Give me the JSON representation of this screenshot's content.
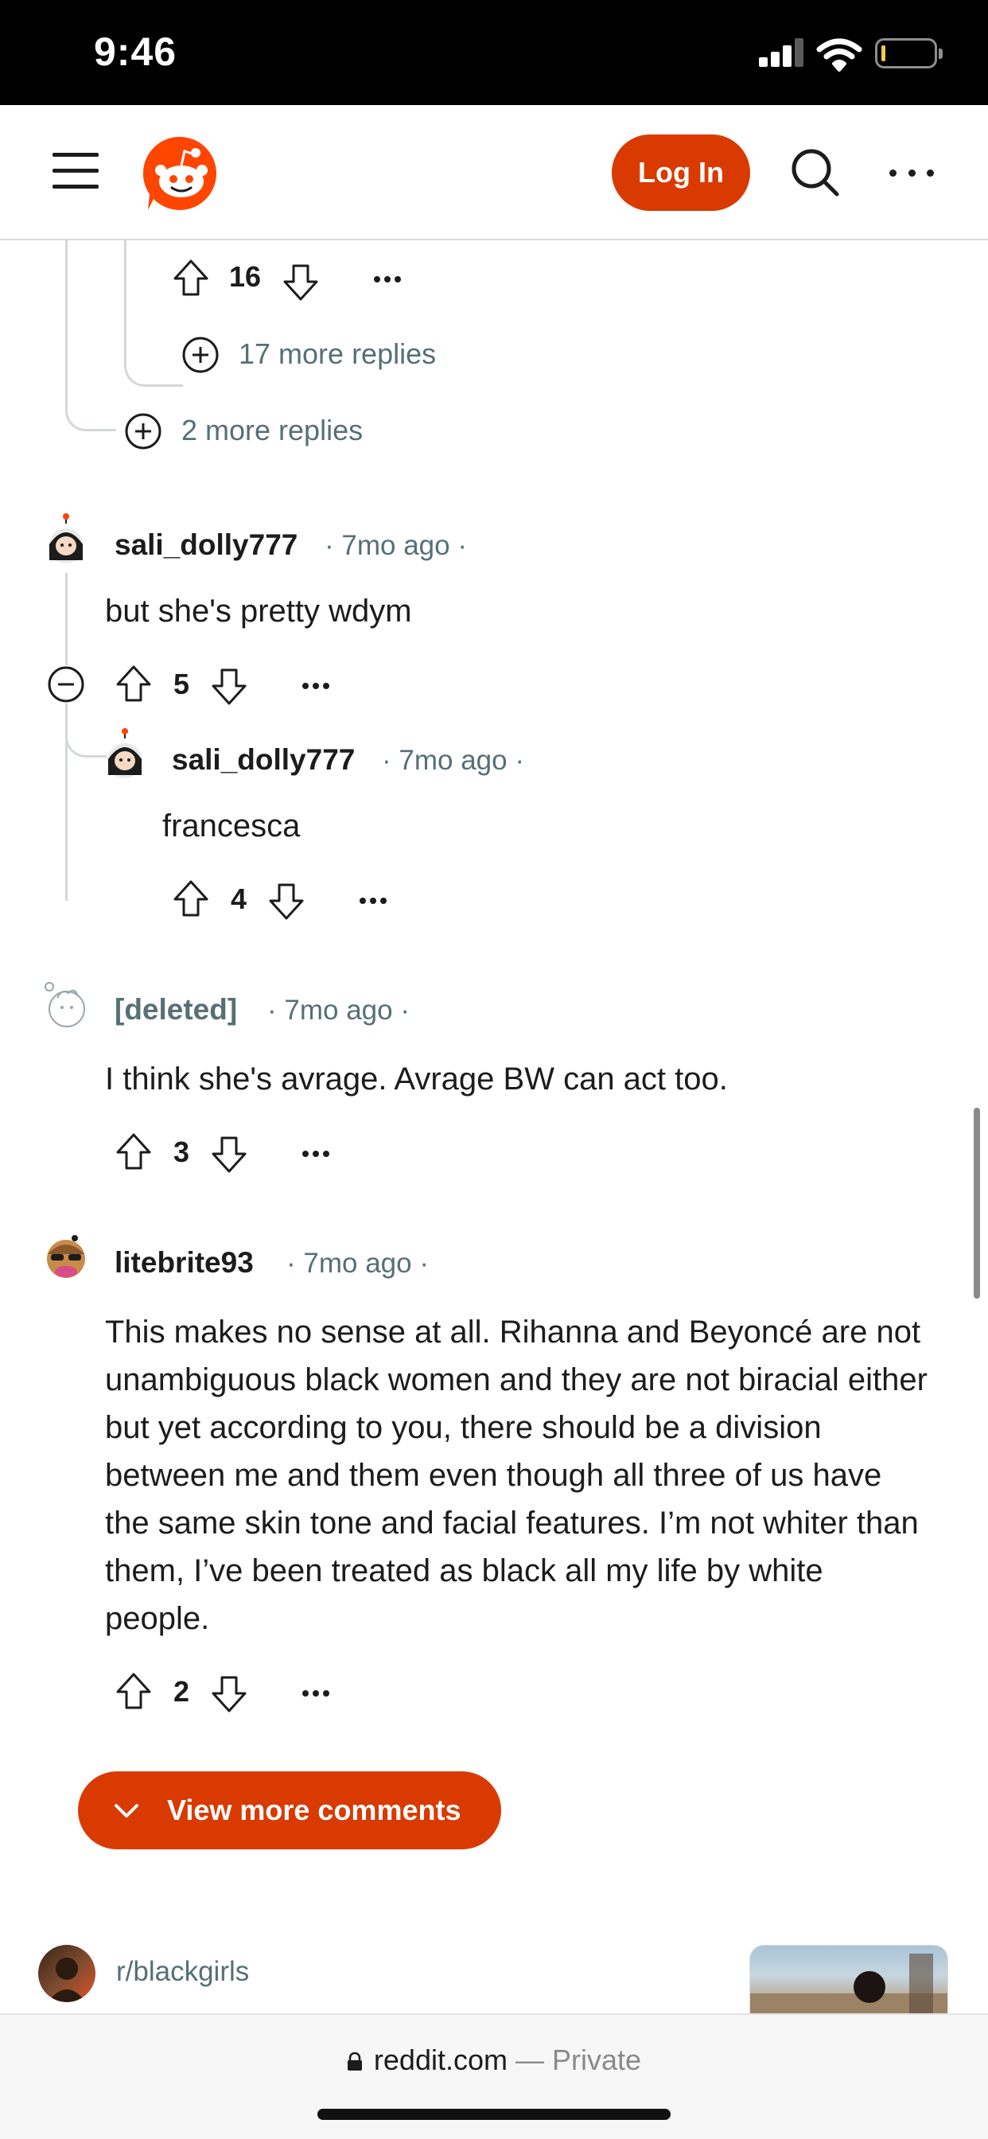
{
  "status_bar": {
    "time": "9:46"
  },
  "header": {
    "login_label": "Log In"
  },
  "partial_comment": {
    "votes": "16",
    "nested_more_replies": "17 more replies",
    "more_replies": "2 more replies"
  },
  "comments": [
    {
      "author": "sali_dolly777",
      "time": "7mo ago",
      "text": "but she's pretty wdym",
      "votes": "5"
    },
    {
      "author": "sali_dolly777",
      "time": "7mo ago",
      "text": "francesca",
      "votes": "4"
    },
    {
      "author": "[deleted]",
      "time": "7mo ago",
      "text": "I think she's avrage. Avrage BW can act too.",
      "votes": "3"
    },
    {
      "author": "litebrite93",
      "time": "7mo ago",
      "text": "This makes no sense at all. Rihanna and Beyoncé are not unambiguous black women and they are not biracial either but yet according to you, there should be a division between me and them even though all three of us have the same skin tone and facial features. I’m not whiter than them, I’ve been treated as black all my life by white people.",
      "votes": "2"
    }
  ],
  "view_more_label": "View more comments",
  "related": {
    "subreddit": "r/blackgirls"
  },
  "browser": {
    "domain": "reddit.com",
    "separator": "—",
    "mode": "Private"
  },
  "colors": {
    "accent": "#d93a00",
    "meta": "#576f76",
    "thread": "#d4d7d9"
  }
}
